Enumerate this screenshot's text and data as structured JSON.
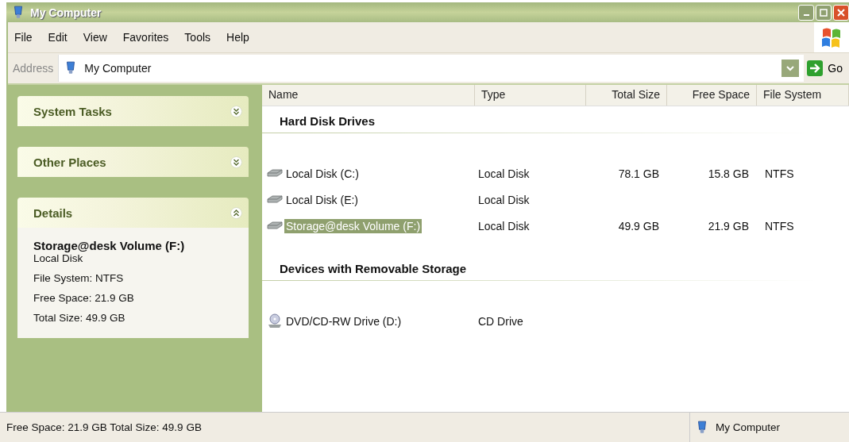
{
  "window": {
    "title": "My Computer"
  },
  "menu": [
    "File",
    "Edit",
    "View",
    "Favorites",
    "Tools",
    "Help"
  ],
  "address": {
    "label": "Address",
    "value": "My Computer",
    "go": "Go"
  },
  "sidebar": [
    {
      "title": "System Tasks",
      "expanded": false
    },
    {
      "title": "Other Places",
      "expanded": false
    },
    {
      "title": "Details",
      "expanded": true,
      "heading": "Storage@desk Volume (F:)",
      "lines": [
        "Local Disk",
        "File System: NTFS",
        "Free Space: 21.9 GB",
        "Total Size: 49.9 GB"
      ]
    }
  ],
  "columns": [
    {
      "label": "Name"
    },
    {
      "label": "Type"
    },
    {
      "label": "Total Size"
    },
    {
      "label": "Free Space"
    },
    {
      "label": "File System"
    }
  ],
  "groups": [
    {
      "title": "Hard Disk Drives",
      "items": [
        {
          "kind": "hdd",
          "name": "Local Disk (C:)",
          "type": "Local Disk",
          "total_size": "78.1 GB",
          "free_space": "15.8 GB",
          "file_system": "NTFS",
          "selected": false
        },
        {
          "kind": "hdd",
          "name": "Local Disk (E:)",
          "type": "Local Disk",
          "selected": false
        },
        {
          "kind": "hdd",
          "name": "Storage@desk Volume (F:)",
          "type": "Local Disk",
          "total_size": "49.9 GB",
          "free_space": "21.9 GB",
          "file_system": "NTFS",
          "selected": true
        }
      ]
    },
    {
      "title": "Devices with Removable Storage",
      "items": [
        {
          "kind": "cd",
          "name": "DVD/CD-RW Drive (D:)",
          "type": "CD Drive",
          "selected": false
        }
      ]
    }
  ],
  "status_bar": {
    "text": "Free Space: 21.9 GB Total Size: 49.9 GB",
    "zone": "My Computer"
  }
}
